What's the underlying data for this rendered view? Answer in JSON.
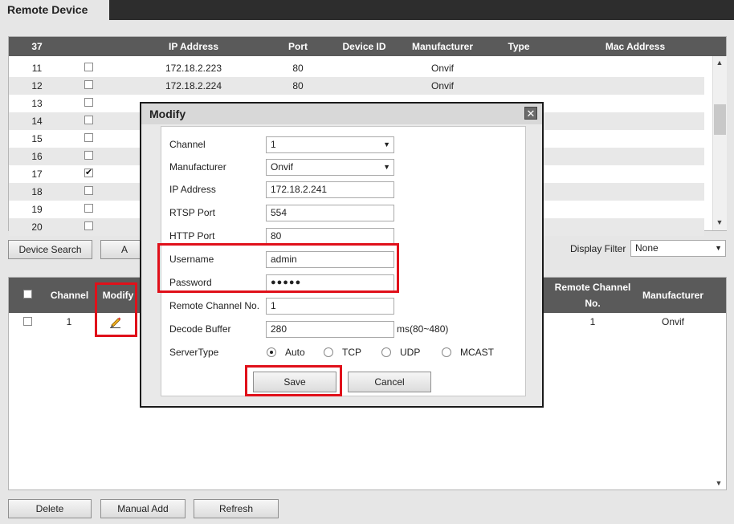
{
  "window": {
    "title": "Remote Device"
  },
  "search_table": {
    "headers": [
      "37",
      "IP Address",
      "Port",
      "Device ID",
      "Manufacturer",
      "Type",
      "Mac Address"
    ],
    "rows": [
      {
        "no": "11",
        "checked": false,
        "ip": "172.18.2.223",
        "port": "80",
        "manufacturer": "Onvif"
      },
      {
        "no": "12",
        "checked": false,
        "ip": "172.18.2.224",
        "port": "80",
        "manufacturer": "Onvif"
      },
      {
        "no": "13",
        "checked": false,
        "ip": "",
        "port": "",
        "manufacturer": ""
      },
      {
        "no": "14",
        "checked": false,
        "ip": "",
        "port": "",
        "manufacturer": ""
      },
      {
        "no": "15",
        "checked": false,
        "ip": "",
        "port": "",
        "manufacturer": ""
      },
      {
        "no": "16",
        "checked": false,
        "ip": "",
        "port": "",
        "manufacturer": ""
      },
      {
        "no": "17",
        "checked": true,
        "ip": "",
        "port": "",
        "manufacturer": ""
      },
      {
        "no": "18",
        "checked": false,
        "ip": "",
        "port": "",
        "manufacturer": ""
      },
      {
        "no": "19",
        "checked": false,
        "ip": "",
        "port": "",
        "manufacturer": ""
      },
      {
        "no": "20",
        "checked": false,
        "ip": "",
        "port": "",
        "manufacturer": ""
      }
    ]
  },
  "toolbar_top": {
    "device_search": "Device Search",
    "add_partial": "A",
    "display_filter_label": "Display Filter",
    "display_filter_value": "None"
  },
  "added_table": {
    "headers": {
      "channel": "Channel",
      "modify": "Modify",
      "remote_channel_1": "Remote Channel",
      "remote_channel_2": "No.",
      "manufacturer": "Manufacturer"
    },
    "rows": [
      {
        "channel": "1",
        "remote_channel": "1",
        "manufacturer": "Onvif"
      }
    ]
  },
  "toolbar_bottom": {
    "delete": "Delete",
    "manual_add": "Manual Add",
    "refresh": "Refresh"
  },
  "dialog": {
    "title": "Modify",
    "close_glyph": "✕",
    "fields": {
      "channel": {
        "label": "Channel",
        "value": "1"
      },
      "manufacturer": {
        "label": "Manufacturer",
        "value": "Onvif"
      },
      "ip": {
        "label": "IP Address",
        "value": "172.18.2.241"
      },
      "rtsp": {
        "label": "RTSP Port",
        "value": "554"
      },
      "http": {
        "label": "HTTP Port",
        "value": "80"
      },
      "username": {
        "label": "Username",
        "value": "admin"
      },
      "password": {
        "label": "Password",
        "value": "●●●●●"
      },
      "remote_channel": {
        "label": "Remote Channel No.",
        "value": "1"
      },
      "decode_buffer": {
        "label": "Decode Buffer",
        "value": "280",
        "unit": "ms(80~480)"
      }
    },
    "server_type": {
      "label": "ServerType",
      "options": [
        "Auto",
        "TCP",
        "UDP",
        "MCAST"
      ],
      "selected": "Auto"
    },
    "save": "Save",
    "cancel": "Cancel"
  },
  "colors": {
    "highlight": "#e0101a",
    "header_bg": "#5a5a5a",
    "titlebar": "#2d2d2d"
  },
  "icons": {
    "modify": "pencil-icon",
    "close": "close-icon"
  }
}
